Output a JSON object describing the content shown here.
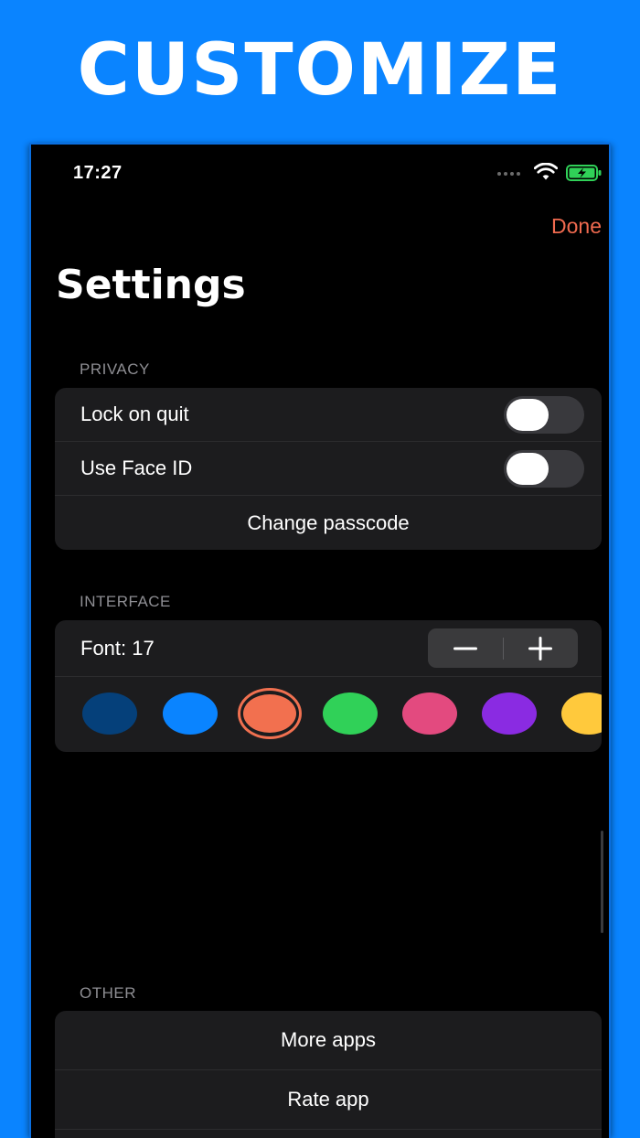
{
  "promo": {
    "title": "CUSTOMIZE"
  },
  "status_bar": {
    "time": "17:27",
    "icons": [
      "signal-dots-icon",
      "wifi-icon",
      "battery-charging-icon"
    ]
  },
  "nav": {
    "done_label": "Done",
    "title": "Settings"
  },
  "privacy": {
    "header": "PRIVACY",
    "lock_on_quit": {
      "label": "Lock on quit",
      "enabled": false
    },
    "use_face_id": {
      "label": "Use Face ID",
      "enabled": false
    },
    "change_passcode_label": "Change passcode"
  },
  "interface": {
    "header": "INTERFACE",
    "font_label": "Font: 17",
    "stepper_icons": [
      "minus-icon",
      "plus-icon"
    ],
    "colors": [
      {
        "name": "navy",
        "hex": "#05407a",
        "selected": false
      },
      {
        "name": "blue",
        "hex": "#0a84ff",
        "selected": false
      },
      {
        "name": "orange",
        "hex": "#f2704f",
        "selected": true
      },
      {
        "name": "green",
        "hex": "#30d158",
        "selected": false
      },
      {
        "name": "pink",
        "hex": "#e34a7f",
        "selected": false
      },
      {
        "name": "purple",
        "hex": "#8a2be2",
        "selected": false
      },
      {
        "name": "yellow",
        "hex": "#ffc93c",
        "selected": false
      }
    ]
  },
  "other": {
    "header": "OTHER",
    "more_apps_label": "More apps",
    "rate_app_label": "Rate app"
  },
  "theme": {
    "accent": "#f06a4f",
    "brand_blue": "#0a84ff",
    "background": "#000000",
    "group_background": "#1c1c1e"
  }
}
